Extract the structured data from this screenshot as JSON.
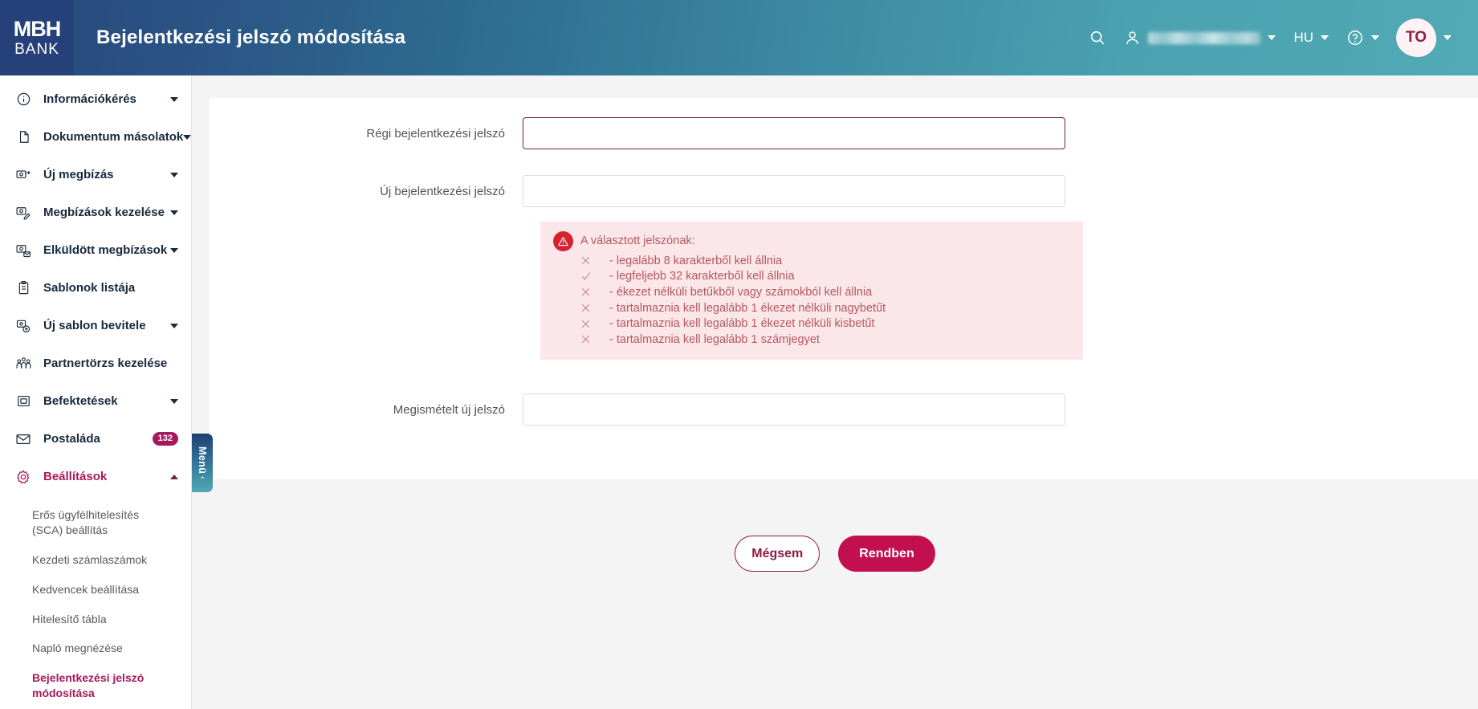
{
  "header": {
    "logo_mbh": "MBH",
    "logo_bank": "BANK",
    "title": "Bejelentkezési jelszó módosítása",
    "search_icon": "search-icon",
    "user_icon": "user-icon",
    "user_name": "",
    "language": "HU",
    "help_icon": "question-circle-icon",
    "avatar_initials": "TO"
  },
  "sidebar": {
    "items": [
      {
        "label": "Információkérés",
        "icon": "info-circle-icon",
        "caret": "down",
        "active": false
      },
      {
        "label": "Dokumentum másolatok",
        "icon": "document-icon",
        "caret": "down",
        "active": false
      },
      {
        "label": "Új megbízás",
        "icon": "new-order-icon",
        "caret": "down",
        "active": false
      },
      {
        "label": "Megbízások kezelése",
        "icon": "manage-orders-icon",
        "caret": "down",
        "active": false
      },
      {
        "label": "Elküldött megbízások",
        "icon": "sent-orders-icon",
        "caret": "down",
        "active": false
      },
      {
        "label": "Sablonok listája",
        "icon": "clipboard-icon",
        "caret": "none",
        "active": false
      },
      {
        "label": "Új sablon bevitele",
        "icon": "add-template-icon",
        "caret": "down",
        "active": false
      },
      {
        "label": "Partnertörzs kezelése",
        "icon": "partners-icon",
        "caret": "none",
        "active": false
      },
      {
        "label": "Befektetések",
        "icon": "investments-icon",
        "caret": "down",
        "active": false
      },
      {
        "label": "Postaláda",
        "icon": "mail-icon",
        "caret": "none",
        "badge": "132",
        "active": false
      },
      {
        "label": "Beállítások",
        "icon": "gear-icon",
        "caret": "up",
        "active": true
      }
    ],
    "subitems": [
      {
        "label": "Erős ügyfélhitelesítés (SCA) beállítás",
        "active": false
      },
      {
        "label": "Kezdeti számlaszámok",
        "active": false
      },
      {
        "label": "Kedvencek beállítása",
        "active": false
      },
      {
        "label": "Hitelesítő tábla",
        "active": false
      },
      {
        "label": "Napló megnézése",
        "active": false
      },
      {
        "label": "Bejelentkezési jelszó módosítása",
        "active": true
      }
    ],
    "menu_tab": {
      "label": "Menü",
      "chevron": "‹"
    }
  },
  "form": {
    "fields": [
      {
        "label": "Régi bejelentkezési jelszó",
        "value": "",
        "focused": true
      },
      {
        "label": "Új bejelentkezési jelszó",
        "value": "",
        "focused": false
      },
      {
        "label": "Megismételt új jelszó",
        "value": "",
        "focused": false
      }
    ]
  },
  "validation": {
    "icon": "warning-triangle-icon",
    "title": "A választott jelszónak:",
    "rules": [
      {
        "status": "fail",
        "mark": "✕",
        "text": "- legalább 8 karakterből kell állnia"
      },
      {
        "status": "pass",
        "mark": "✓",
        "text": "- legfeljebb 32 karakterből kell állnia"
      },
      {
        "status": "fail",
        "mark": "✕",
        "text": "- ékezet nélküli betűkből vagy számokból kell állnia"
      },
      {
        "status": "fail",
        "mark": "✕",
        "text": "- tartalmaznia kell legalább 1 ékezet nélküli nagybetűt"
      },
      {
        "status": "fail",
        "mark": "✕",
        "text": "- tartalmaznia kell legalább 1 ékezet nélküli kisbetűt"
      },
      {
        "status": "fail",
        "mark": "✕",
        "text": "- tartalmaznia kell legalább 1 számjegyet"
      }
    ]
  },
  "buttons": {
    "cancel": "Mégsem",
    "confirm": "Rendben"
  },
  "colors": {
    "brand_pink": "#c2104e",
    "brand_magenta": "#a51a5c",
    "header_navy": "#26417a",
    "header_teal": "#52aab5",
    "error_bg": "#fbe7ea",
    "error_red": "#d52231"
  }
}
